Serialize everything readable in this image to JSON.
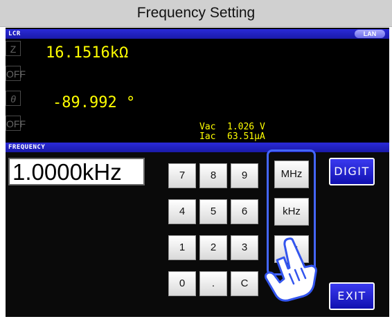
{
  "title": "Frequency Setting",
  "lcr_bar": {
    "label": "LCR",
    "lan": "LAN"
  },
  "params": [
    {
      "label": "Z",
      "italic": false
    },
    {
      "label": "OFF",
      "italic": false
    },
    {
      "label": "θ",
      "italic": true
    },
    {
      "label": "OFF",
      "italic": false
    }
  ],
  "measurements": {
    "primary": "16.1516kΩ",
    "secondary": "-89.992 °",
    "vac_label": "Vac",
    "vac_value": "1.026 V",
    "iac_label": "Iac",
    "iac_value": "63.51μA"
  },
  "frequency_bar": {
    "label": "FREQUENCY"
  },
  "frequency_value": "1.0000kHz",
  "keypad": [
    "7",
    "8",
    "9",
    "4",
    "5",
    "6",
    "1",
    "2",
    "3",
    "0",
    ".",
    "C"
  ],
  "units": [
    "MHz",
    "kHz",
    "Hz"
  ],
  "buttons": {
    "digit": "DIGIT",
    "exit": "EXIT"
  },
  "colors": {
    "accent_blue": "#1a1aa8",
    "highlight": "#4466ff",
    "readout": "#ffff00"
  }
}
